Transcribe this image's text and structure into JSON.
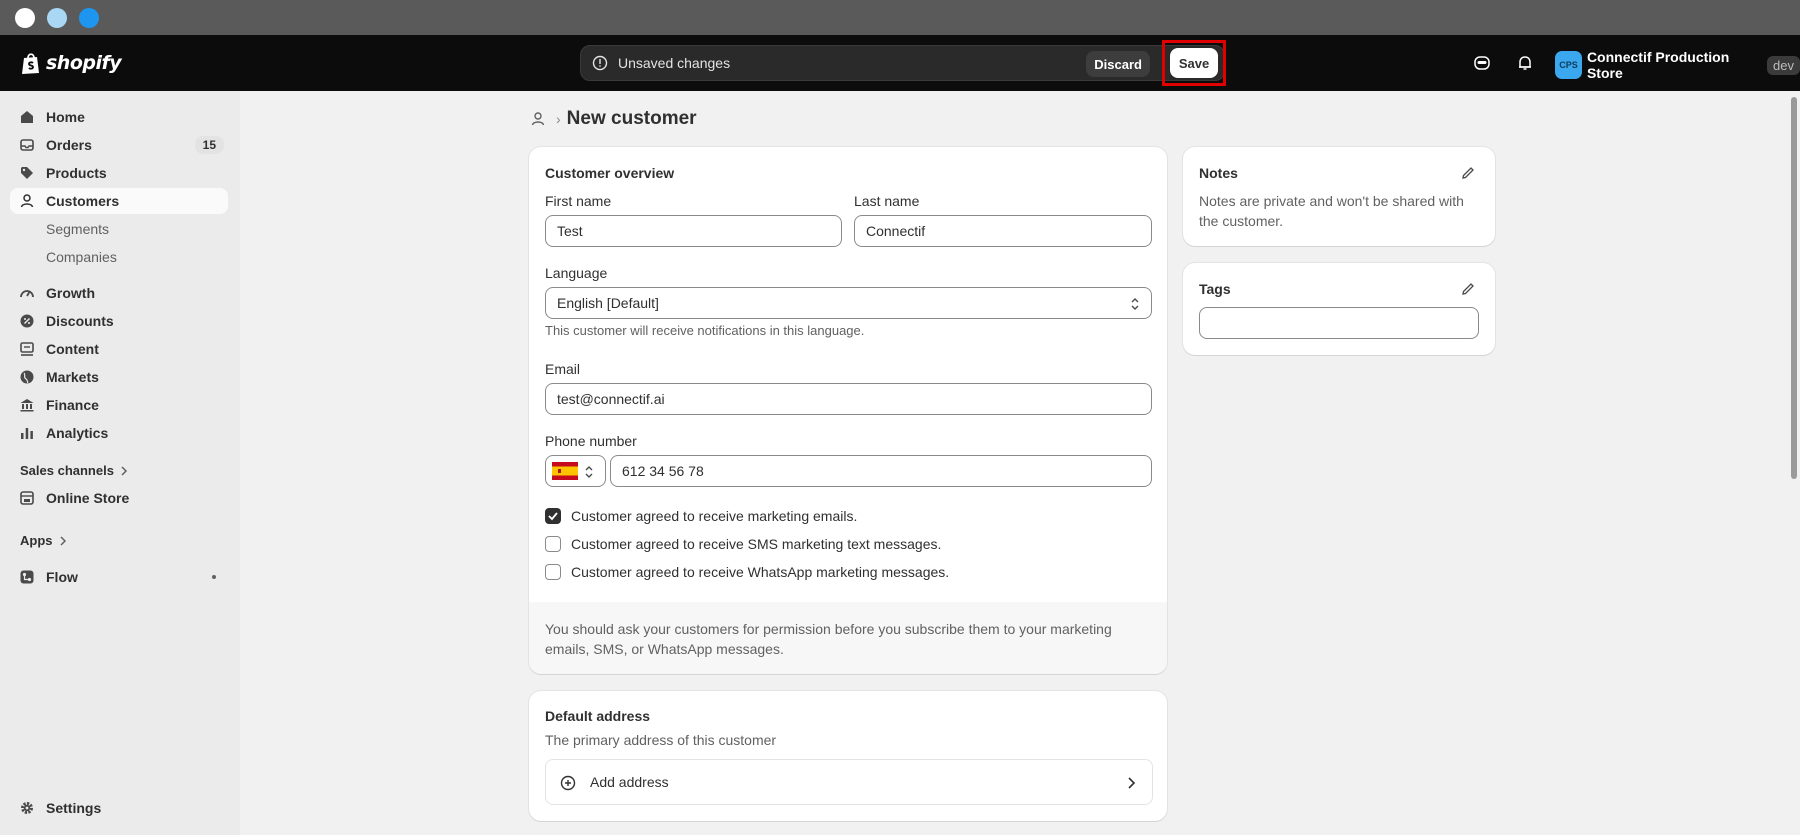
{
  "window": {
    "dots": [
      "#ffffff",
      "#a9d8f5",
      "#1e96f0"
    ]
  },
  "topbar": {
    "logo_text": "shopify",
    "unsaved_text": "Unsaved changes",
    "discard_label": "Discard",
    "save_label": "Save",
    "store_initials": "CPS",
    "store_name": "Connectif Production Store",
    "store_badge": "dev",
    "icons": [
      "sidekick-icon",
      "bell-icon"
    ]
  },
  "sidebar": {
    "items": [
      {
        "label": "Home",
        "icon": "home-icon"
      },
      {
        "label": "Orders",
        "icon": "orders-icon",
        "badge": "15"
      },
      {
        "label": "Products",
        "icon": "tag-icon"
      },
      {
        "label": "Customers",
        "icon": "person-icon",
        "active": true
      },
      {
        "label": "Segments",
        "sub": true
      },
      {
        "label": "Companies",
        "sub": true
      },
      {
        "label": "Growth",
        "icon": "gauge-icon"
      },
      {
        "label": "Discounts",
        "icon": "discount-icon"
      },
      {
        "label": "Content",
        "icon": "content-icon"
      },
      {
        "label": "Markets",
        "icon": "globe-icon"
      },
      {
        "label": "Finance",
        "icon": "bank-icon"
      },
      {
        "label": "Analytics",
        "icon": "bar-chart-icon"
      }
    ],
    "sales_channels_label": "Sales channels",
    "online_store_label": "Online Store",
    "apps_label": "Apps",
    "flow_label": "Flow",
    "settings_label": "Settings"
  },
  "page": {
    "title": "New customer"
  },
  "overview": {
    "heading": "Customer overview",
    "first_name_label": "First name",
    "first_name_value": "Test",
    "last_name_label": "Last name",
    "last_name_value": "Connectif",
    "language_label": "Language",
    "language_value": "English [Default]",
    "language_help": "This customer will receive notifications in this language.",
    "email_label": "Email",
    "email_value": "test@connectif.ai",
    "phone_label": "Phone number",
    "phone_value": "612 34 56 78",
    "country_flag": "spain-flag",
    "consents": [
      {
        "label": "Customer agreed to receive marketing emails.",
        "checked": true
      },
      {
        "label": "Customer agreed to receive SMS marketing text messages.",
        "checked": false
      },
      {
        "label": "Customer agreed to receive WhatsApp marketing messages.",
        "checked": false
      }
    ],
    "permission_note": "You should ask your customers for permission before you subscribe them to your marketing emails, SMS, or WhatsApp messages."
  },
  "address": {
    "heading": "Default address",
    "subtext": "The primary address of this customer",
    "add_label": "Add address"
  },
  "notes": {
    "heading": "Notes",
    "text": "Notes are private and won't be shared with the customer."
  },
  "tags": {
    "heading": "Tags",
    "value": ""
  },
  "colors": {
    "topbar_bg": "#0c0c0c",
    "save_highlight": "#e00000",
    "sidebar_bg": "#ebebeb",
    "main_bg": "#f1f1f1"
  }
}
